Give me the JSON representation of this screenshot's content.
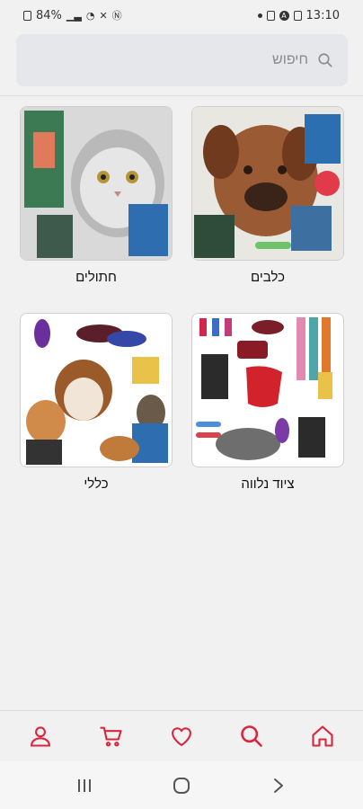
{
  "status_bar": {
    "battery": "84%",
    "time": "13:10"
  },
  "search": {
    "placeholder": "חיפוש"
  },
  "categories": [
    {
      "label": "כלבים"
    },
    {
      "label": "חתולים"
    },
    {
      "label": "ציוד נלווה"
    },
    {
      "label": "כללי"
    }
  ],
  "bottom_nav": {
    "items": [
      "home-icon",
      "search-icon",
      "heart-icon",
      "cart-icon",
      "user-icon"
    ],
    "accent": "#d7263d"
  },
  "system_nav": {
    "items": [
      "recents-icon",
      "home-circle-icon",
      "back-icon"
    ]
  }
}
